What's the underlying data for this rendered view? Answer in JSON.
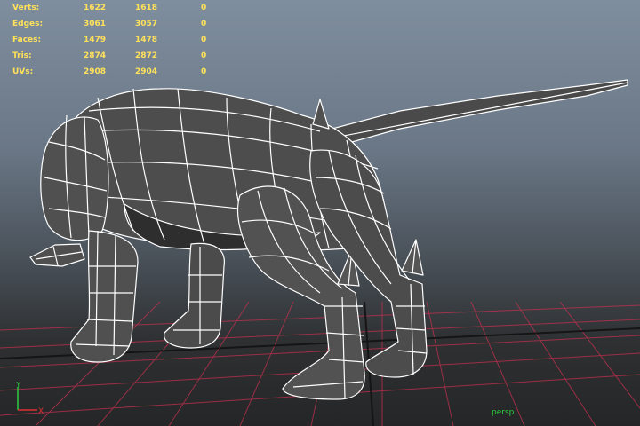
{
  "hud": {
    "rows": [
      {
        "label": "Verts:",
        "v1": "1622",
        "v2": "1618",
        "v3": "0"
      },
      {
        "label": "Edges:",
        "v1": "3061",
        "v2": "3057",
        "v3": "0"
      },
      {
        "label": "Faces:",
        "v1": "1479",
        "v2": "1478",
        "v3": "0"
      },
      {
        "label": "Tris:",
        "v1": "2874",
        "v2": "2872",
        "v3": "0"
      },
      {
        "label": "UVs:",
        "v1": "2908",
        "v2": "2904",
        "v3": "0"
      }
    ]
  },
  "viewport": {
    "camera": "persp",
    "grid_color": "#c2304f",
    "grid_axis_color": "#151515",
    "hud_color": "#ffe15a",
    "wire_color": "#ffffff",
    "mesh_color": "#4d4d4d"
  },
  "axis_indicator": {
    "y_label": "Y",
    "x_label": "X",
    "y_color": "#2ecc40",
    "x_color": "#e03030"
  }
}
